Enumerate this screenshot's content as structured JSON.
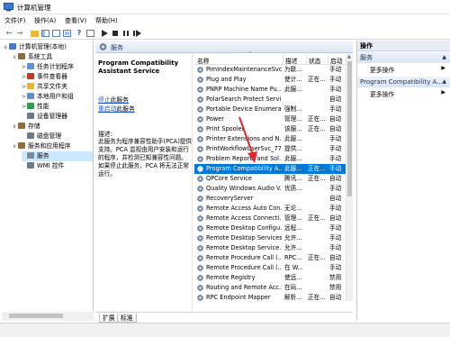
{
  "window": {
    "title": "计算机管理"
  },
  "menu": [
    "文件(F)",
    "操作(A)",
    "查看(V)",
    "帮助(H)"
  ],
  "toolbar": {
    "icons": [
      "back-arrow",
      "forward-arrow",
      "up-folder",
      "show-hide-tree",
      "refresh",
      "export-list",
      "help",
      "properties",
      "start",
      "stop",
      "pause",
      "restart"
    ]
  },
  "tree": {
    "items": [
      {
        "label": "计算机管理(本地)",
        "indent": 0,
        "arrow": "∨",
        "color": "#4a78c2"
      },
      {
        "label": "系统工具",
        "indent": 1,
        "arrow": "∨",
        "color": "#8c6d3f"
      },
      {
        "label": "任务计划程序",
        "indent": 2,
        "arrow": ">",
        "color": "#5e8fd1"
      },
      {
        "label": "事件查看器",
        "indent": 2,
        "arrow": ">",
        "color": "#c0392b"
      },
      {
        "label": "共享文件夹",
        "indent": 2,
        "arrow": ">",
        "color": "#e3b33d"
      },
      {
        "label": "本地用户和组",
        "indent": 2,
        "arrow": ">",
        "color": "#5e8fd1"
      },
      {
        "label": "性能",
        "indent": 2,
        "arrow": ">",
        "color": "#2e9d4a"
      },
      {
        "label": "设备管理器",
        "indent": 2,
        "arrow": "",
        "color": "#6c7a89"
      },
      {
        "label": "存储",
        "indent": 1,
        "arrow": "∨",
        "color": "#8c6d3f"
      },
      {
        "label": "磁盘管理",
        "indent": 2,
        "arrow": "",
        "color": "#6c7a89"
      },
      {
        "label": "服务和应用程序",
        "indent": 1,
        "arrow": "∨",
        "color": "#8c6d3f"
      },
      {
        "label": "服务",
        "indent": 2,
        "arrow": "",
        "color": "#7a8a99",
        "selected": true
      },
      {
        "label": "WMI 控件",
        "indent": 2,
        "arrow": "",
        "color": "#6c7a89"
      }
    ]
  },
  "center": {
    "header": "服务",
    "selected_service": "Program Compatibility Assistant Service",
    "stop_link": "停止",
    "stop_suffix": "此服务",
    "restart_link": "重启动",
    "restart_suffix": "此服务",
    "desc_label": "描述:",
    "desc_text": "此服务为程序兼容性助手(PCA)提供支持。PCA 监视由用户安装和运行的程序，并检测已知兼容性问题。如果停止此服务，PCA 将无法正常运行。"
  },
  "list": {
    "columns": [
      "名称",
      "描述",
      "状态",
      "启动"
    ],
    "sort_indicator": "^",
    "rows": [
      {
        "name": "PimIndexMaintenanceSvc...",
        "desc": "为联...",
        "status": "",
        "start": "手动"
      },
      {
        "name": "Plug and Play",
        "desc": "使计...",
        "status": "正在...",
        "start": "手动"
      },
      {
        "name": "PNRP Machine Name Pu...",
        "desc": "此服...",
        "status": "",
        "start": "手动"
      },
      {
        "name": "PolarSearch Protect Servi...",
        "desc": "",
        "status": "",
        "start": "自动"
      },
      {
        "name": "Portable Device Enumera...",
        "desc": "强制...",
        "status": "",
        "start": "手动"
      },
      {
        "name": "Power",
        "desc": "管理...",
        "status": "正在...",
        "start": "自动"
      },
      {
        "name": "Print Spooler",
        "desc": "该服...",
        "status": "正在...",
        "start": "自动"
      },
      {
        "name": "Printer Extensions and N...",
        "desc": "此服...",
        "status": "",
        "start": "手动"
      },
      {
        "name": "PrintWorkflowUserSvc_77...",
        "desc": "提供...",
        "status": "",
        "start": "手动"
      },
      {
        "name": "Problem Reports and Sol...",
        "desc": "此服...",
        "status": "",
        "start": "手动"
      },
      {
        "name": "Program Compatibility A...",
        "desc": "此服...",
        "status": "正在...",
        "start": "手动",
        "selected": true
      },
      {
        "name": "QPCore Service",
        "desc": "腾讯...",
        "status": "正在...",
        "start": "自动"
      },
      {
        "name": "Quality Windows Audio V...",
        "desc": "优质...",
        "status": "",
        "start": "手动"
      },
      {
        "name": "RecoveryServer",
        "desc": "",
        "status": "",
        "start": "自动"
      },
      {
        "name": "Remote Access Auto Con...",
        "desc": "无论...",
        "status": "",
        "start": "手动"
      },
      {
        "name": "Remote Access Connecti...",
        "desc": "管理...",
        "status": "正在...",
        "start": "自动"
      },
      {
        "name": "Remote Desktop Configu...",
        "desc": "远程...",
        "status": "",
        "start": "手动"
      },
      {
        "name": "Remote Desktop Services",
        "desc": "允许...",
        "status": "",
        "start": "手动"
      },
      {
        "name": "Remote Desktop Service...",
        "desc": "允许...",
        "status": "",
        "start": "手动"
      },
      {
        "name": "Remote Procedure Call (...",
        "desc": "RPC...",
        "status": "正在...",
        "start": "自动"
      },
      {
        "name": "Remote Procedure Call (...",
        "desc": "在 W...",
        "status": "",
        "start": "手动"
      },
      {
        "name": "Remote Registry",
        "desc": "使远...",
        "status": "",
        "start": "禁用"
      },
      {
        "name": "Routing and Remote Acc...",
        "desc": "在局...",
        "status": "",
        "start": "禁用"
      },
      {
        "name": "RPC Endpoint Mapper",
        "desc": "解析...",
        "status": "正在...",
        "start": "自动"
      }
    ]
  },
  "tabs": [
    "扩展",
    "标准"
  ],
  "actions": {
    "header": "操作",
    "section1": "服务",
    "section2": "Program Compatibility A...",
    "more": "更多操作"
  },
  "colors": {
    "selection": "#0078d7",
    "tree_selection": "#cce8ff",
    "link": "#1a55c8",
    "annotation_arrow": "#e0262e"
  }
}
